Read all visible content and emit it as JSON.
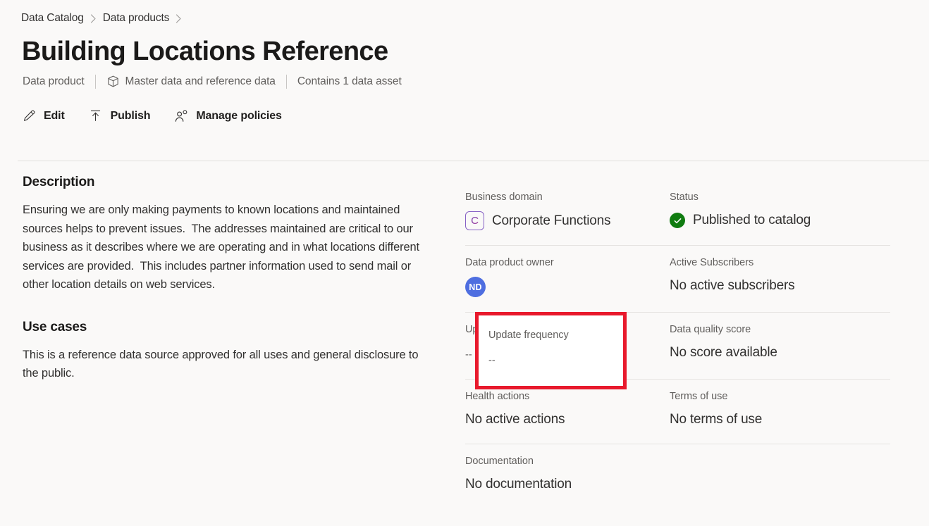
{
  "breadcrumb": {
    "items": [
      {
        "label": "Data Catalog"
      },
      {
        "label": "Data products"
      }
    ],
    "separator_icon": "chevron-right-icon"
  },
  "header": {
    "title": "Building Locations Reference",
    "subtitle": {
      "type_label": "Data product",
      "domain_icon": "cube-icon",
      "domain_label": "Master data and reference data",
      "asset_count_label": "Contains 1 data asset"
    }
  },
  "command_bar": {
    "buttons": [
      {
        "label": "Edit",
        "icon": "pencil-icon"
      },
      {
        "label": "Publish",
        "icon": "publish-up-arrow-icon"
      },
      {
        "label": "Manage policies",
        "icon": "person-policy-icon"
      }
    ]
  },
  "description_section": {
    "title": "Description",
    "body": "Ensuring we are only making payments to known locations and maintained sources helps to prevent issues.  The addresses maintained are critical to our business as it describes where we are operating and in what locations different services are provided.  This includes partner information used to send mail or other location details on web services."
  },
  "use_cases_section": {
    "title": "Use cases",
    "body": "This is a reference data source approved for all uses and general disclosure to the public."
  },
  "metadata": {
    "business_domain": {
      "label": "Business domain",
      "chip_initial": "C",
      "value": "Corporate Functions"
    },
    "status": {
      "label": "Status",
      "icon": "check-circle-icon",
      "value": "Published to catalog"
    },
    "data_product_owner": {
      "label": "Data product owner",
      "avatar_initials": "ND"
    },
    "active_subscribers": {
      "label": "Active Subscribers",
      "value": "No active subscribers"
    },
    "update_frequency": {
      "label": "Update frequency",
      "value": "--",
      "highlighted": true
    },
    "data_quality_score": {
      "label": "Data quality score",
      "value": "No score available"
    },
    "health_actions": {
      "label": "Health actions",
      "value": "No active actions"
    },
    "terms_of_use": {
      "label": "Terms of use",
      "value": "No terms of use"
    },
    "documentation": {
      "label": "Documentation",
      "value": "No documentation"
    }
  },
  "colors": {
    "page_background": "#faf9f8",
    "accent_purple": "#8661c5",
    "status_green": "#107c10",
    "avatar_blue": "#4e6ee0",
    "highlight_red": "#e8192c",
    "divider": "#e5e3e1",
    "secondary_text": "#605e5c"
  }
}
